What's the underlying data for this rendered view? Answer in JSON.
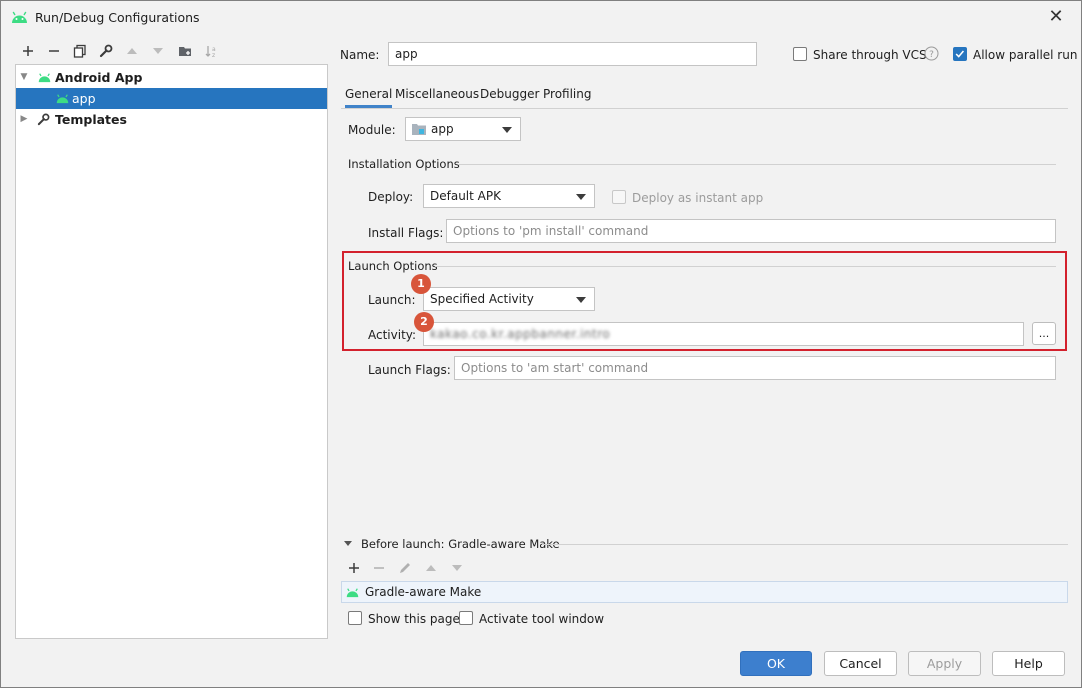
{
  "window": {
    "title": "Run/Debug Configurations",
    "close_glyph": "✕"
  },
  "tree": {
    "items": [
      {
        "label": "Android App",
        "icon": "android-icon",
        "expanded": true
      },
      {
        "label": "app",
        "icon": "android-icon",
        "selected": true
      },
      {
        "label": "Templates",
        "icon": "wrench-icon",
        "expanded": false
      }
    ]
  },
  "toolbar": {
    "icons": [
      "add-icon",
      "remove-icon",
      "copy-icon",
      "wrench-icon",
      "move-up-icon",
      "move-down-icon",
      "new-folder-icon",
      "sort-icon"
    ]
  },
  "header": {
    "name_label": "Name:",
    "name_value": "app",
    "share_vcs_label": "Share through VCS",
    "share_vcs_checked": false,
    "allow_parallel_label": "Allow parallel run",
    "allow_parallel_checked": true
  },
  "tabs": [
    {
      "label": "General",
      "active": true
    },
    {
      "label": "Miscellaneous"
    },
    {
      "label": "Debugger"
    },
    {
      "label": "Profiling"
    }
  ],
  "module": {
    "label": "Module:",
    "value": "app"
  },
  "installation": {
    "section_label": "Installation Options",
    "deploy_label": "Deploy:",
    "deploy_value": "Default APK",
    "instant_app_label": "Deploy as instant app",
    "install_flags_label": "Install Flags:",
    "install_flags_placeholder": "Options to 'pm install' command"
  },
  "launch": {
    "section_label": "Launch Options",
    "launch_label": "Launch:",
    "launch_value": "Specified Activity",
    "activity_label": "Activity:",
    "activity_value": "kakao.co.kr.appbanner.intro",
    "browse_label": "...",
    "launch_flags_label": "Launch Flags:",
    "launch_flags_placeholder": "Options to 'am start' command",
    "badges": [
      "1",
      "2"
    ]
  },
  "before_launch": {
    "section_label": "Before launch: Gradle-aware Make",
    "task": "Gradle-aware Make",
    "show_page_label": "Show this page",
    "activate_window_label": "Activate tool window"
  },
  "buttons": {
    "ok": "OK",
    "cancel": "Cancel",
    "apply": "Apply",
    "help": "Help"
  },
  "colors": {
    "selection": "#2675bf",
    "primary_button": "#3d7fce",
    "highlight": "#d3212d",
    "badge": "#d8553a",
    "android": "#3ddc84"
  }
}
